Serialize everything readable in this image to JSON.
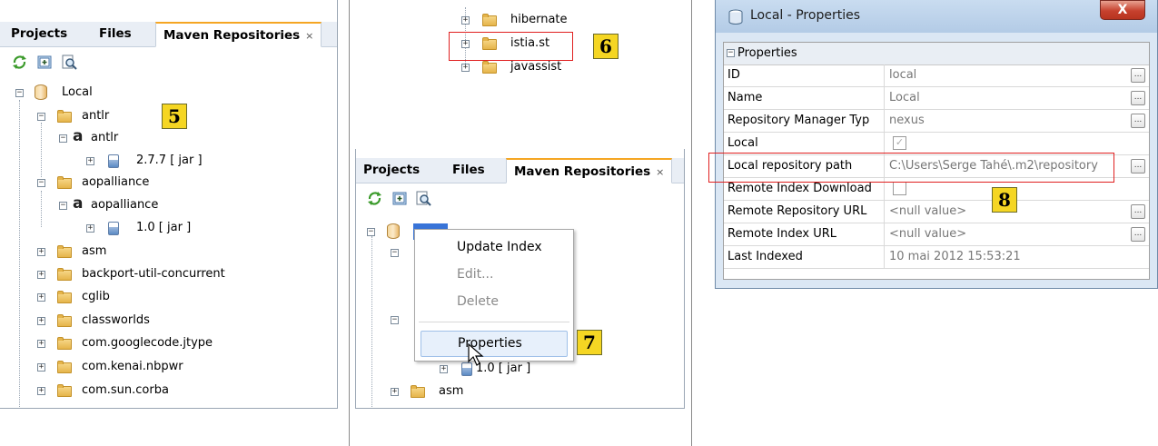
{
  "left_panel": {
    "tabs": [
      {
        "label": "Projects"
      },
      {
        "label": "Files"
      },
      {
        "label": "Maven Repositories",
        "close": "×"
      }
    ],
    "toolbar_icons": [
      "refresh-icon",
      "add-repository-icon",
      "find-icon"
    ],
    "tree": [
      {
        "label": "Local",
        "icon": "database-icon",
        "expander": "−"
      },
      {
        "label": "antlr",
        "icon": "folder-icon",
        "expander": "−"
      },
      {
        "label": "antlr",
        "icon": "artifact-icon",
        "expander": "−"
      },
      {
        "label": "2.7.7 [ jar ]",
        "icon": "jar-icon",
        "expander": "+"
      },
      {
        "label": "aopalliance",
        "icon": "folder-icon",
        "expander": "−"
      },
      {
        "label": "aopalliance",
        "icon": "artifact-icon",
        "expander": "−"
      },
      {
        "label": "1.0 [ jar ]",
        "icon": "jar-icon",
        "expander": "+"
      },
      {
        "label": "asm",
        "icon": "folder-icon",
        "expander": "+"
      },
      {
        "label": "backport-util-concurrent",
        "icon": "folder-icon",
        "expander": "+"
      },
      {
        "label": "cglib",
        "icon": "folder-icon",
        "expander": "+"
      },
      {
        "label": "classworlds",
        "icon": "folder-icon",
        "expander": "+"
      },
      {
        "label": "com.googlecode.jtype",
        "icon": "folder-icon",
        "expander": "+"
      },
      {
        "label": "com.kenai.nbpwr",
        "icon": "folder-icon",
        "expander": "+"
      },
      {
        "label": "com.sun.corba",
        "icon": "folder-icon",
        "expander": "+"
      }
    ],
    "badge": "5"
  },
  "middle_top": {
    "tree": [
      {
        "label": "hibernate",
        "icon": "folder-icon",
        "expander": "+"
      },
      {
        "label": "istia.st",
        "icon": "folder-icon",
        "expander": "+"
      },
      {
        "label": "javassist",
        "icon": "folder-icon",
        "expander": "+"
      }
    ],
    "badge": "6"
  },
  "middle_panel": {
    "tabs": [
      {
        "label": "Projects"
      },
      {
        "label": "Files"
      },
      {
        "label": "Maven Repositories",
        "close": "×"
      }
    ],
    "tree_visible": [
      {
        "label": "1.0 [ jar ]",
        "icon": "jar-icon",
        "expander": "+"
      },
      {
        "label": "asm",
        "icon": "folder-icon",
        "expander": "+"
      }
    ],
    "context_menu": [
      {
        "label": "Update Index",
        "enabled": true
      },
      {
        "label": "Edit...",
        "enabled": false
      },
      {
        "label": "Delete",
        "enabled": false
      },
      {
        "label": "Properties",
        "enabled": true
      }
    ],
    "badge": "7"
  },
  "properties_dialog": {
    "title": "Local - Properties",
    "close_glyph": "X",
    "section": "Properties",
    "section_expander": "−",
    "rows": [
      {
        "name": "ID",
        "value": "local",
        "type": "text",
        "ellipsis": true
      },
      {
        "name": "Name",
        "value": "Local",
        "type": "text",
        "ellipsis": true
      },
      {
        "name": "Repository Manager Typ",
        "value": "nexus",
        "type": "text",
        "ellipsis": true
      },
      {
        "name": "Local",
        "value": "✓",
        "type": "checkbox",
        "ellipsis": false
      },
      {
        "name": "Local repository path",
        "value": "C:\\Users\\Serge Tahé\\.m2\\repository",
        "type": "text",
        "ellipsis": true
      },
      {
        "name": "Remote Index Download",
        "value": "",
        "type": "checkbox",
        "ellipsis": false
      },
      {
        "name": "Remote Repository URL",
        "value": "<null value>",
        "type": "text",
        "ellipsis": true
      },
      {
        "name": "Remote Index URL",
        "value": "<null value>",
        "type": "text",
        "ellipsis": true
      },
      {
        "name": "Last Indexed",
        "value": "10 mai 2012 15:53:21",
        "type": "text",
        "ellipsis": false
      }
    ],
    "badge": "8"
  }
}
